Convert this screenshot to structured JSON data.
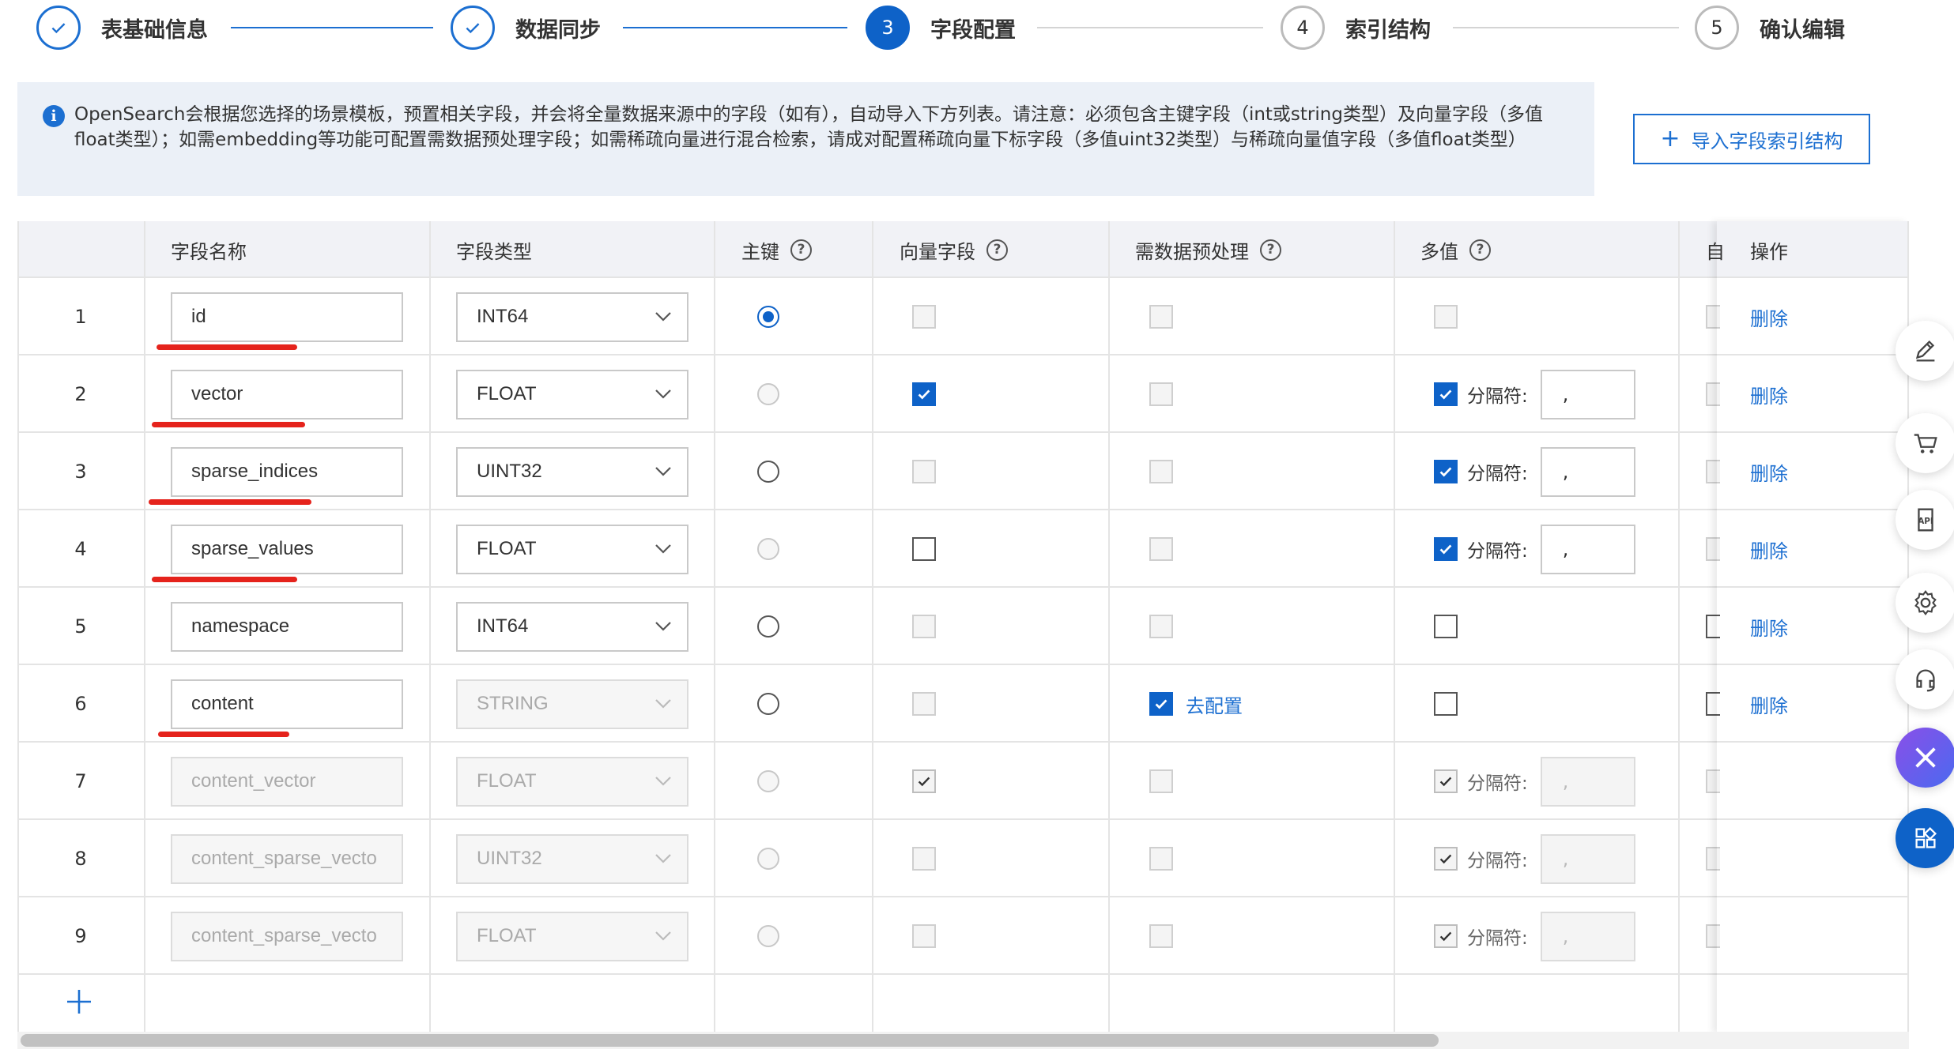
{
  "steps": [
    {
      "number": "1",
      "label": "表基础信息",
      "state": "done"
    },
    {
      "number": "2",
      "label": "数据同步",
      "state": "done"
    },
    {
      "number": "3",
      "label": "字段配置",
      "state": "active"
    },
    {
      "number": "4",
      "label": "索引结构",
      "state": "pending"
    },
    {
      "number": "5",
      "label": "确认编辑",
      "state": "pending"
    }
  ],
  "info": {
    "text": "OpenSearch会根据您选择的场景模板，预置相关字段，并会将全量数据来源中的字段（如有），自动导入下方列表。请注意：必须包含主键字段（int或string类型）及向量字段（多值float类型）；如需embedding等功能可配置需数据预处理字段；如需稀疏向量进行混合检索，请成对配置稀疏向量下标字段（多值uint32类型）与稀疏向量值字段（多值float类型）",
    "import_button": "导入字段索引结构"
  },
  "table": {
    "headers": {
      "field_name": "字段名称",
      "field_type": "字段类型",
      "primary_key": "主键",
      "vector_field": "向量字段",
      "preprocess": "需数据预处理",
      "multi_value": "多值",
      "cut_column": "自",
      "operation": "操作"
    },
    "separator_label": "分隔符:",
    "delete_label": "删除",
    "configure_label": "去配置",
    "rows": [
      {
        "no": "1",
        "name": "id",
        "type": "INT64",
        "editable": true,
        "pk": "checked",
        "vector": "off",
        "preprocess": "off",
        "multi": "off",
        "sep": null,
        "configure": false,
        "deletable": true,
        "underlined": true
      },
      {
        "no": "2",
        "name": "vector",
        "type": "FLOAT",
        "editable": true,
        "pk": "disabled",
        "vector": "on",
        "preprocess": "off",
        "multi": "on",
        "sep": ",",
        "configure": false,
        "deletable": true,
        "underlined": true
      },
      {
        "no": "3",
        "name": "sparse_indices",
        "type": "UINT32",
        "editable": true,
        "pk": "enabled",
        "vector": "off",
        "preprocess": "off",
        "multi": "on",
        "sep": ",",
        "configure": false,
        "deletable": true,
        "underlined": true
      },
      {
        "no": "4",
        "name": "sparse_values",
        "type": "FLOAT",
        "editable": true,
        "pk": "disabled",
        "vector": "enabled",
        "preprocess": "off",
        "multi": "on",
        "sep": ",",
        "configure": false,
        "deletable": true,
        "underlined": true
      },
      {
        "no": "5",
        "name": "namespace",
        "type": "INT64",
        "editable": true,
        "pk": "enabled",
        "vector": "off",
        "preprocess": "off",
        "multi": "enabled",
        "sep": null,
        "configure": false,
        "deletable": true,
        "underlined": false
      },
      {
        "no": "6",
        "name": "content",
        "type": "STRING",
        "editable": true,
        "type_disabled": true,
        "pk": "enabled",
        "vector": "off",
        "preprocess": "on",
        "multi": "enabled",
        "sep": null,
        "configure": true,
        "deletable": true,
        "underlined": true
      },
      {
        "no": "7",
        "name": "content_vector",
        "type": "FLOAT",
        "editable": false,
        "pk": "disabled",
        "vector": "on-disabled",
        "preprocess": "off",
        "multi": "on-disabled",
        "sep": ",",
        "configure": false,
        "deletable": false,
        "underlined": false
      },
      {
        "no": "8",
        "name": "content_sparse_vecto",
        "type": "UINT32",
        "editable": false,
        "pk": "disabled",
        "vector": "off",
        "preprocess": "off",
        "multi": "on-disabled",
        "sep": ",",
        "configure": false,
        "deletable": false,
        "underlined": false
      },
      {
        "no": "9",
        "name": "content_sparse_vecto",
        "type": "FLOAT",
        "editable": false,
        "pk": "disabled",
        "vector": "off",
        "preprocess": "off",
        "multi": "on-disabled",
        "sep": ",",
        "configure": false,
        "deletable": false,
        "underlined": false
      }
    ]
  },
  "side_toolbar": [
    "edit-icon",
    "cart-icon",
    "api-icon",
    "gear-icon",
    "headset-icon",
    "ai-assistant-icon",
    "apps-grid-icon"
  ],
  "colors": {
    "accent": "#1c6fd1",
    "active_step": "#0e62c8",
    "highlight": "#e5231c",
    "banner_bg": "#ebf0f7",
    "header_bg": "#f1f2f6"
  }
}
